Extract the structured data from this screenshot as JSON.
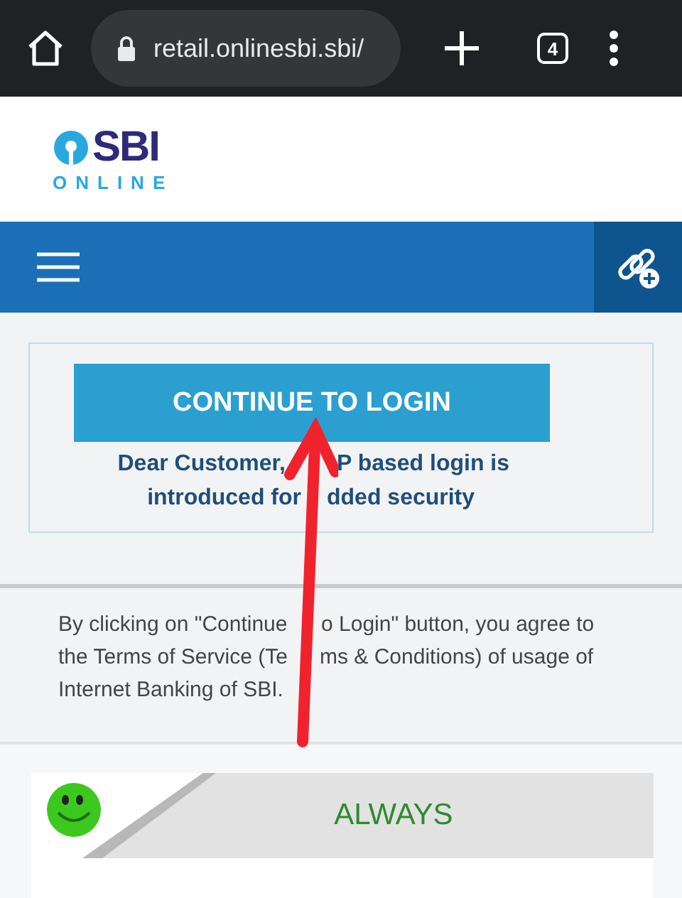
{
  "browser": {
    "url": "retail.onlinesbi.sbi/",
    "tab_count": "4"
  },
  "logo": {
    "name": "SBI",
    "tagline": "ONLINE"
  },
  "login": {
    "button": "CONTINUE TO LOGIN",
    "notice_lines": [
      [
        "Dear Customer,",
        "P based login is"
      ],
      [
        "introduced for",
        "dded security"
      ]
    ]
  },
  "terms_lines": [
    [
      "By clicking on \"Continue",
      "o Login\" button, you agree to"
    ],
    [
      "the Terms of Service (Te",
      "ms & Conditions) of usage of"
    ],
    [
      "Internet Banking of SBI."
    ]
  ],
  "banner": {
    "title": "ALWAYS"
  }
}
